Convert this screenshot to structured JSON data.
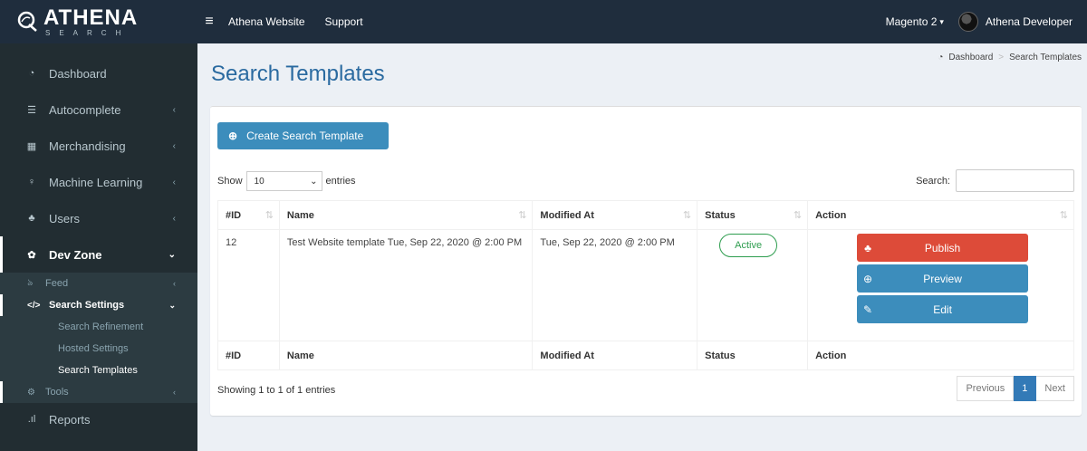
{
  "brand": {
    "name": "ATHENA",
    "sub": "SEARCH"
  },
  "topbar": {
    "nav": [
      "Athena Website",
      "Support"
    ],
    "store": "Magento 2",
    "user": "Athena Developer"
  },
  "sidebar": {
    "items": [
      {
        "label": "Dashboard",
        "icon": "dashboard-icon"
      },
      {
        "label": "Autocomplete",
        "icon": "list-icon"
      },
      {
        "label": "Merchandising",
        "icon": "grid-icon"
      },
      {
        "label": "Machine Learning",
        "icon": "lightbulb-icon"
      },
      {
        "label": "Users",
        "icon": "users-icon"
      },
      {
        "label": "Dev Zone",
        "icon": "gear-icon"
      }
    ],
    "devzone": {
      "feed": "Feed",
      "search_settings": "Search Settings",
      "search_settings_children": [
        "Search Refinement",
        "Hosted Settings",
        "Search Templates"
      ],
      "tools": "Tools"
    },
    "reports": "Reports"
  },
  "page": {
    "title": "Search Templates",
    "breadcrumb": [
      "Dashboard",
      "Search Templates"
    ]
  },
  "toolbar": {
    "create_label": "Create Search Template",
    "show_label": "Show",
    "entries_value": "10",
    "entries_label": "entries",
    "search_label": "Search:"
  },
  "table": {
    "headers": [
      "#ID",
      "Name",
      "Modified At",
      "Status",
      "Action"
    ],
    "rows": [
      {
        "id": "12",
        "name": "Test Website template Tue, Sep 22, 2020 @ 2:00 PM",
        "modified": "Tue, Sep 22, 2020 @ 2:00 PM",
        "status": "Active",
        "actions": [
          "Publish",
          "Preview",
          "Edit"
        ]
      }
    ]
  },
  "footer": {
    "info": "Showing 1 to 1 of 1 entries",
    "pager": {
      "prev": "Previous",
      "current": "1",
      "next": "Next"
    }
  },
  "colors": {
    "topbar": "#1f2d3d",
    "sidebar": "#222d32",
    "primary": "#3c8dbc",
    "danger": "#dd4b39",
    "success": "#2e9d4f",
    "title": "#2a6aa0"
  }
}
